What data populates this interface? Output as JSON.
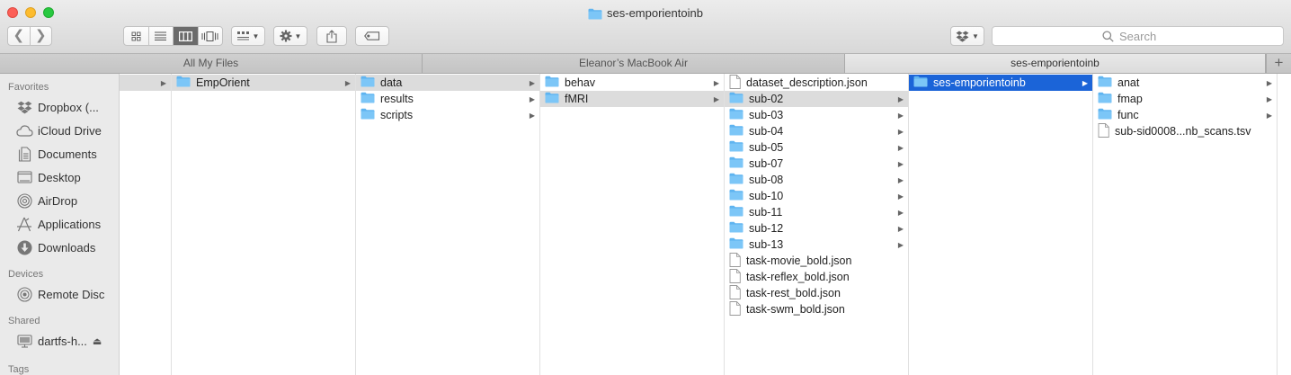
{
  "window": {
    "title": "ses-emporientoinb"
  },
  "toolbar": {
    "back": "❮",
    "forward": "❯",
    "view_modes": [
      "icon-view",
      "list-view",
      "column-view",
      "cover-flow-view"
    ],
    "active_view": "column-view"
  },
  "search": {
    "placeholder": "Search"
  },
  "tabs": [
    {
      "label": "All My Files",
      "active": false
    },
    {
      "label": "Eleanor’s MacBook Air",
      "active": false
    },
    {
      "label": "ses-emporientoinb",
      "active": true
    }
  ],
  "sidebar": {
    "favorites_header": "Favorites",
    "favorites": [
      {
        "label": "Dropbox (...",
        "icon": "dropbox-icon"
      },
      {
        "label": "iCloud Drive",
        "icon": "cloud-icon"
      },
      {
        "label": "Documents",
        "icon": "documents-icon"
      },
      {
        "label": "Desktop",
        "icon": "desktop-icon"
      },
      {
        "label": "AirDrop",
        "icon": "airdrop-icon"
      },
      {
        "label": "Applications",
        "icon": "applications-icon"
      },
      {
        "label": "Downloads",
        "icon": "downloads-icon"
      }
    ],
    "devices_header": "Devices",
    "devices": [
      {
        "label": "Remote Disc",
        "icon": "disc-icon"
      }
    ],
    "shared_header": "Shared",
    "shared": [
      {
        "label": "dartfs-h...",
        "icon": "computer-icon"
      }
    ],
    "tags_header": "Tags"
  },
  "columns": [
    {
      "items": [
        {
          "label": "",
          "type": "folder",
          "state": "path",
          "hidden_label": true
        }
      ]
    },
    {
      "items": [
        {
          "label": "EmpOrient",
          "type": "folder",
          "state": "path"
        }
      ]
    },
    {
      "items": [
        {
          "label": "data",
          "type": "folder",
          "state": "path"
        },
        {
          "label": "results",
          "type": "folder",
          "state": ""
        },
        {
          "label": "scripts",
          "type": "folder",
          "state": ""
        }
      ]
    },
    {
      "items": [
        {
          "label": "behav",
          "type": "folder",
          "state": ""
        },
        {
          "label": "fMRI",
          "type": "folder",
          "state": "path"
        }
      ]
    },
    {
      "items": [
        {
          "label": "dataset_description.json",
          "type": "file",
          "state": ""
        },
        {
          "label": "sub-02",
          "type": "folder",
          "state": "path"
        },
        {
          "label": "sub-03",
          "type": "folder",
          "state": ""
        },
        {
          "label": "sub-04",
          "type": "folder",
          "state": ""
        },
        {
          "label": "sub-05",
          "type": "folder",
          "state": ""
        },
        {
          "label": "sub-07",
          "type": "folder",
          "state": ""
        },
        {
          "label": "sub-08",
          "type": "folder",
          "state": ""
        },
        {
          "label": "sub-10",
          "type": "folder",
          "state": ""
        },
        {
          "label": "sub-11",
          "type": "folder",
          "state": ""
        },
        {
          "label": "sub-12",
          "type": "folder",
          "state": ""
        },
        {
          "label": "sub-13",
          "type": "folder",
          "state": ""
        },
        {
          "label": "task-movie_bold.json",
          "type": "file",
          "state": ""
        },
        {
          "label": "task-reflex_bold.json",
          "type": "file",
          "state": ""
        },
        {
          "label": "task-rest_bold.json",
          "type": "file",
          "state": ""
        },
        {
          "label": "task-swm_bold.json",
          "type": "file",
          "state": ""
        }
      ]
    },
    {
      "items": [
        {
          "label": "ses-emporientoinb",
          "type": "folder",
          "state": "selected"
        }
      ]
    },
    {
      "items": [
        {
          "label": "anat",
          "type": "folder",
          "state": ""
        },
        {
          "label": "fmap",
          "type": "folder",
          "state": ""
        },
        {
          "label": "func",
          "type": "folder",
          "state": ""
        },
        {
          "label": "sub-sid0008...nb_scans.tsv",
          "type": "file",
          "state": ""
        }
      ]
    }
  ],
  "colors": {
    "folder": "#5fb4f0",
    "selection": "#1b64d8",
    "path_highlight": "#dcdcdc"
  }
}
